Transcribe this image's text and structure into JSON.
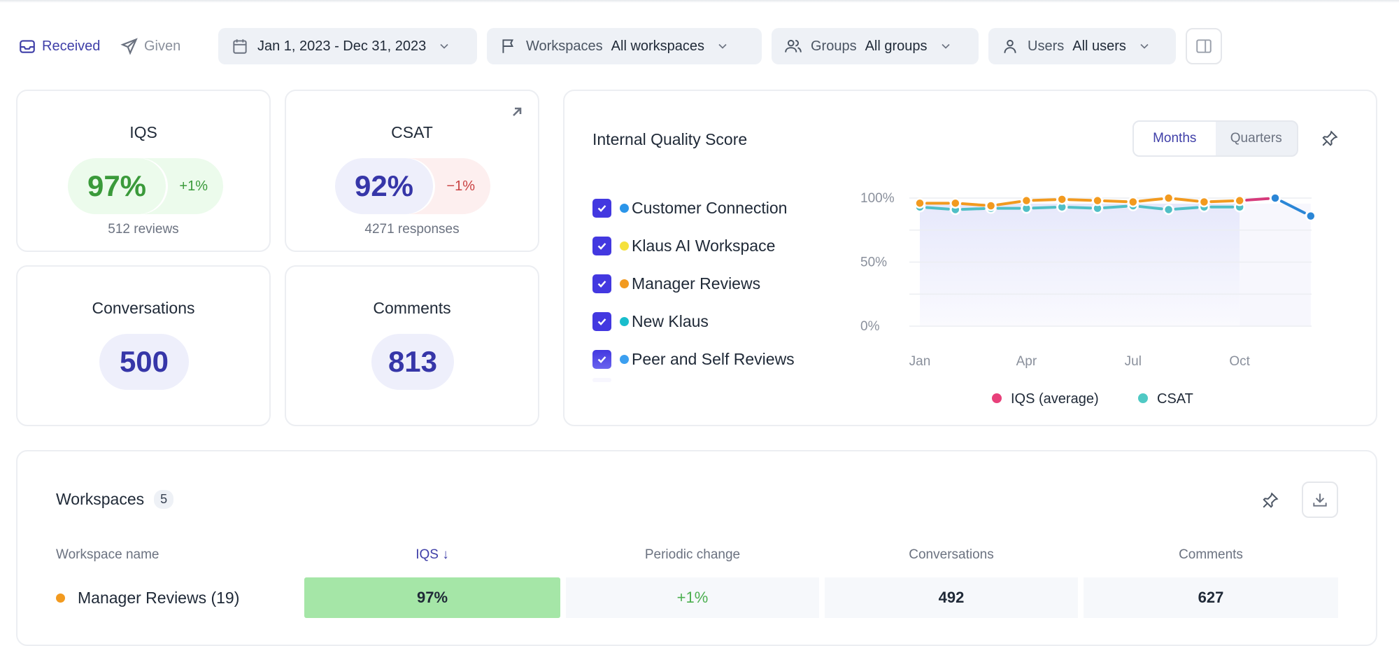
{
  "toolbar": {
    "tabs": [
      {
        "label": "Received",
        "icon": "inbox-icon",
        "active": true
      },
      {
        "label": "Given",
        "icon": "send-icon",
        "active": false
      }
    ],
    "filters": {
      "date": {
        "value": "Jan 1, 2023 - Dec 31, 2023",
        "icon": "calendar-icon"
      },
      "workspaces": {
        "label": "Workspaces",
        "value": "All workspaces",
        "icon": "flag-icon"
      },
      "groups": {
        "label": "Groups",
        "value": "All groups",
        "icon": "users-icon"
      },
      "users": {
        "label": "Users",
        "value": "All users",
        "icon": "user-icon"
      }
    },
    "panel_toggle_icon": "sidebar-panel-icon"
  },
  "kpis": {
    "iqs": {
      "title": "IQS",
      "value": "97%",
      "delta": "+1%",
      "sub": "512 reviews"
    },
    "csat": {
      "title": "CSAT",
      "value": "92%",
      "delta": "−1%",
      "sub": "4271 responses",
      "link_icon": "arrow-up-right-icon"
    },
    "conversations": {
      "title": "Conversations",
      "value": "500"
    },
    "comments": {
      "title": "Comments",
      "value": "813"
    }
  },
  "iqs_panel": {
    "title": "Internal Quality Score",
    "toggle": {
      "options": [
        "Months",
        "Quarters"
      ],
      "selected": "Months"
    },
    "workspaces": [
      {
        "label": "Customer Connection",
        "color": "#2b95e9",
        "checked": true
      },
      {
        "label": "Klaus AI Workspace",
        "color": "#f5e13d",
        "checked": true
      },
      {
        "label": "Manager Reviews",
        "color": "#f29a1f",
        "checked": true
      },
      {
        "label": "New Klaus",
        "color": "#19bdcc",
        "checked": true
      },
      {
        "label": "Peer and Self Reviews",
        "color": "#3b9ff0",
        "checked": true
      }
    ]
  },
  "chart_data": {
    "type": "line",
    "title": "Internal Quality Score",
    "x": [
      "Jan",
      "Feb",
      "Mar",
      "Apr",
      "May",
      "Jun",
      "Jul",
      "Aug",
      "Sep",
      "Oct",
      "Nov",
      "Dec"
    ],
    "x_tick_labels": [
      "Jan",
      "Apr",
      "Jul",
      "Oct"
    ],
    "ylim": [
      0,
      100
    ],
    "y_tick_labels": [
      "100%",
      "50%",
      "0%"
    ],
    "grid": true,
    "legend": {
      "position": "bottom",
      "entries": [
        {
          "name": "IQS (average)",
          "color": "#e8407a"
        },
        {
          "name": "CSAT",
          "color": "#4fc9c4"
        }
      ]
    },
    "series": [
      {
        "name": "CSAT",
        "color": "#4fbfc6",
        "values": [
          93,
          91,
          92,
          92,
          93,
          92,
          94,
          91,
          93,
          93,
          null,
          null
        ]
      },
      {
        "name": "Manager Reviews",
        "color": "#f29a1f",
        "values": [
          96,
          96,
          94,
          98,
          99,
          98,
          97,
          100,
          97,
          98,
          null,
          null
        ]
      },
      {
        "name": "IQS (average)",
        "color": "#d63a7b",
        "values": [
          null,
          null,
          null,
          null,
          null,
          null,
          null,
          null,
          null,
          98,
          100,
          null
        ]
      },
      {
        "name": "Customer Connection",
        "color": "#2b86d6",
        "values": [
          null,
          null,
          null,
          null,
          null,
          null,
          null,
          null,
          null,
          null,
          100,
          86
        ]
      }
    ]
  },
  "workspaces_table": {
    "title": "Workspaces",
    "count": "5",
    "columns": [
      "Workspace name",
      "IQS ↓",
      "Periodic change",
      "Conversations",
      "Comments"
    ],
    "rows": [
      {
        "name": "Manager Reviews (19)",
        "color": "#f29a1f",
        "iqs": "97%",
        "change": "+1%",
        "conversations": "492",
        "comments": "627"
      }
    ]
  }
}
